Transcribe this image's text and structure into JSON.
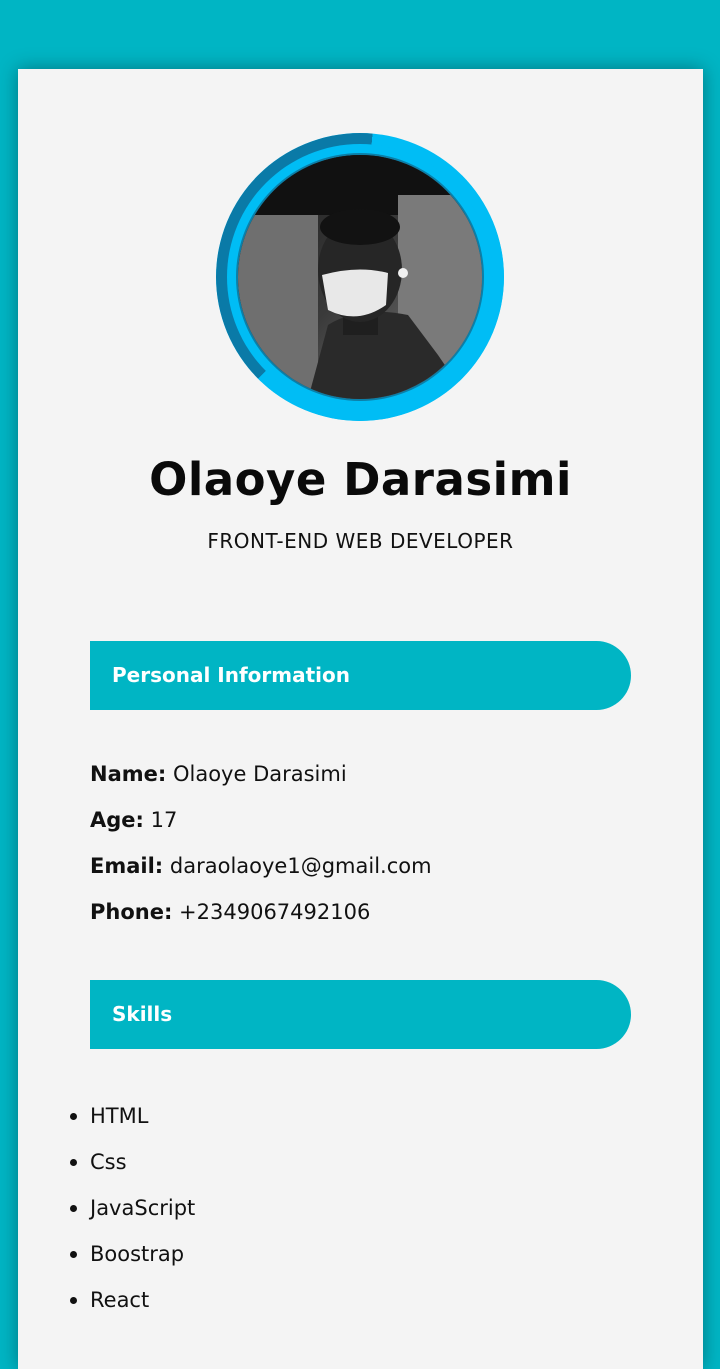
{
  "profile": {
    "name": "Olaoye Darasimi",
    "role": "FRONT-END WEB DEVELOPER",
    "avatar_icon": "profile-photo"
  },
  "sections": {
    "personal_title": "Personal Information",
    "skills_title": "Skills"
  },
  "personal": [
    {
      "label": "Name:",
      "value": "Olaoye Darasimi"
    },
    {
      "label": "Age:",
      "value": "17"
    },
    {
      "label": "Email:",
      "value": "daraolaoye1@gmail.com"
    },
    {
      "label": "Phone:",
      "value": "+2349067492106"
    }
  ],
  "skills": [
    "HTML",
    "Css",
    "JavaScript",
    "Boostrap",
    "React"
  ],
  "colors": {
    "accent": "#00b5c4",
    "card_bg": "#f4f4f4",
    "ring_light": "#00bdf5",
    "ring_dark": "#0a7aa7"
  }
}
